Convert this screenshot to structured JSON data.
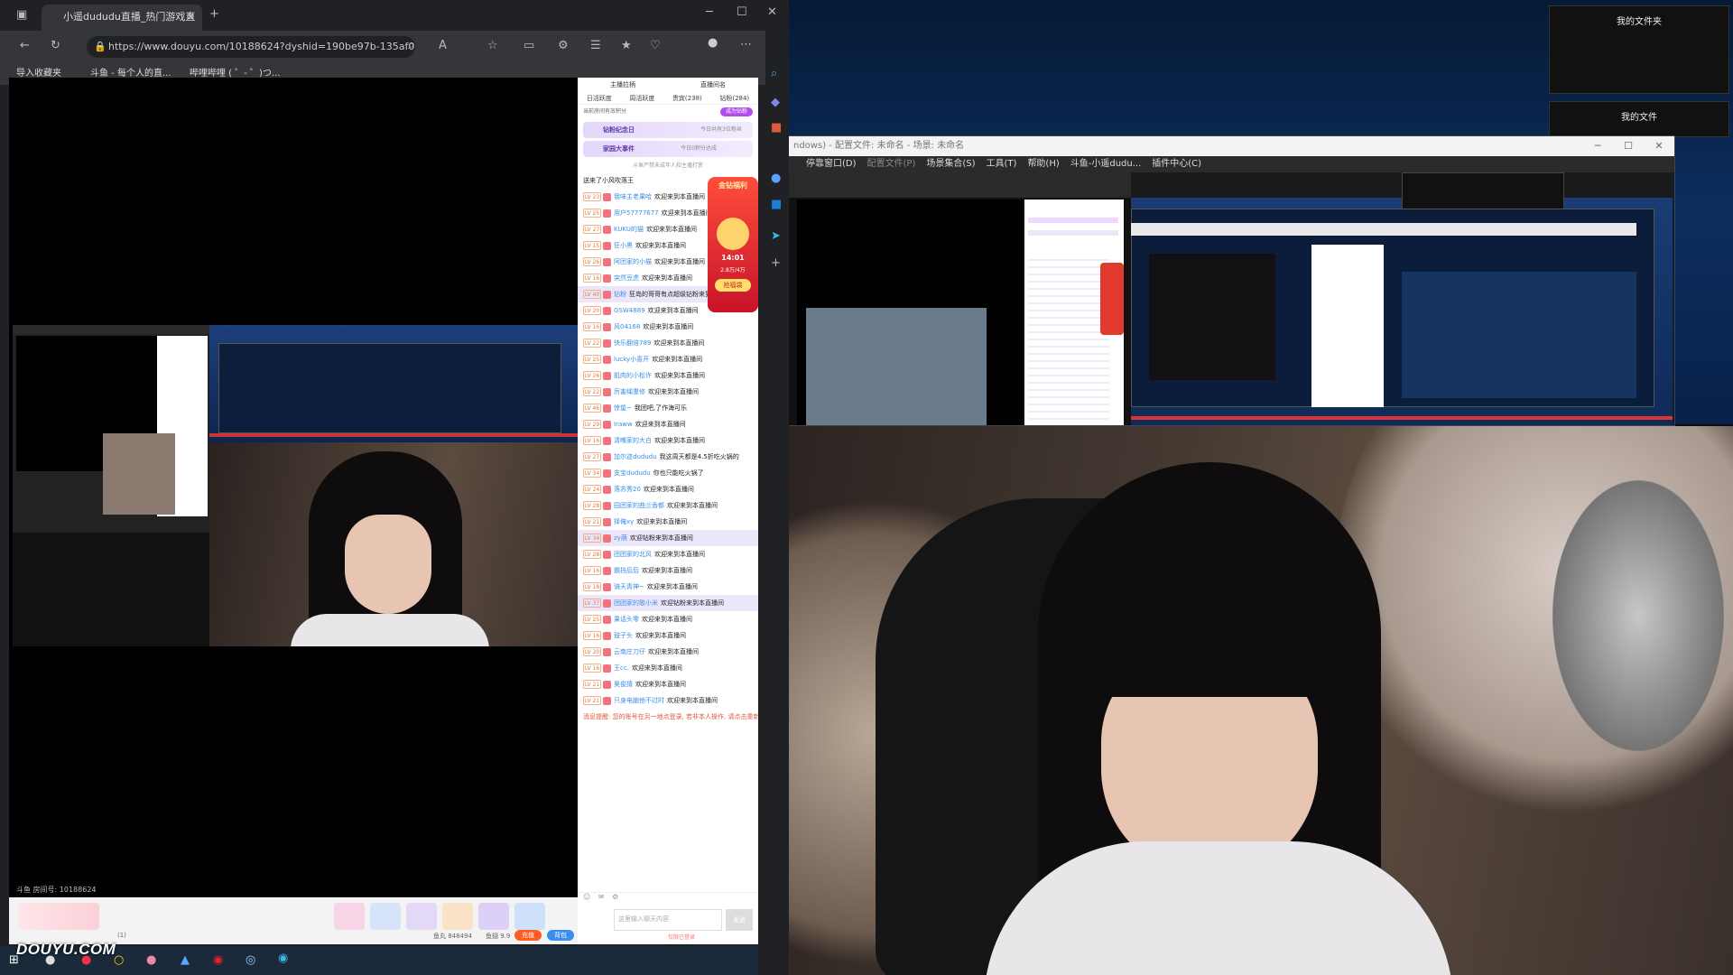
{
  "browser": {
    "tab_title": "小遥dududu直播_热门游戏直播",
    "url": "https://www.douyu.com/10188624?dyshid=190be97b-135af024881...",
    "bookmarks": [
      "导入收藏夹",
      "斗鱼 - 每个人的直...",
      "哔哩哔哩 ( ゜- ゜)つ..."
    ]
  },
  "chat": {
    "header_tabs": [
      "主播拉柄",
      "直播间名"
    ],
    "rank_tabs": [
      "日活跃度",
      "周活跃度",
      "贵宾(238)",
      "钻粉(284)"
    ],
    "notice": "当前房间有效积分",
    "activity_btn": "成为钻粉",
    "banner1": "钻粉纪念日",
    "banner1_sub": "今日共有3位粉丝",
    "banner2": "家园大事件",
    "banner2_sub": "今日0积分达成",
    "system_msg": "斗鱼严禁未成年人和主播打赏",
    "top_pin": "送来了小风吹落王",
    "lines": [
      {
        "lv": "LV 23",
        "user": "我味主老果哈",
        "text": "欢迎来到本直播间"
      },
      {
        "lv": "LV 25",
        "user": "用户57777677",
        "text": "欢迎来到本直播间"
      },
      {
        "lv": "LV 27",
        "user": "KUKU的猫",
        "text": "欢迎来到本直播间"
      },
      {
        "lv": "LV 15",
        "user": "狂小黑",
        "text": "欢迎来到本直播间"
      },
      {
        "lv": "LV 26",
        "user": "阿团家的小猫",
        "text": "欢迎来到本直播间"
      },
      {
        "lv": "LV 16",
        "user": "突然豆虎",
        "text": "欢迎来到本直播间"
      }
    ],
    "gift_line": {
      "lv": "LV 40",
      "user": "钻粉",
      "text": "狂岛的哥哥有点超级钻粉来到本直播间"
    },
    "lines2": [
      {
        "lv": "LV 20",
        "user": "GSW4889",
        "text": "欢迎来到本直播间"
      },
      {
        "lv": "LV 16",
        "user": "风04168",
        "text": "欢迎来到本直播间"
      },
      {
        "lv": "LV 22",
        "user": "快乐翻倍789",
        "text": "欢迎来到本直播间"
      },
      {
        "lv": "LV 25",
        "user": "lucky小喜开",
        "text": "欢迎来到本直播间"
      },
      {
        "lv": "LV 26",
        "user": "肌肉的小松许",
        "text": "欢迎来到本直播间"
      },
      {
        "lv": "LV 22",
        "user": "厉害绳重修",
        "text": "欢迎来到本直播间"
      }
    ],
    "fan_msgs": [
      {
        "lv": "LV 46",
        "user": "惊蛰~",
        "text": "我团吧,了作海可乐"
      },
      {
        "lv": "LV 29",
        "user": "Iraww",
        "text": "欢迎来到本直播间"
      },
      {
        "lv": "LV 16",
        "user": "清嘴家的大白",
        "text": "欢迎来到本直播间"
      },
      {
        "lv": "LV 27",
        "user": "加尔迩dududu",
        "text": "我这周天都是4.5折吃火锅的"
      },
      {
        "lv": "LV 34",
        "user": "支宝dududu",
        "text": "你也只能吃火锅了"
      }
    ],
    "lines3": [
      {
        "lv": "LV 24",
        "user": "落苏秀20",
        "text": "欢迎来到本直播间"
      },
      {
        "lv": "LV 28",
        "user": "园团家的曲兰香都",
        "text": "欢迎来到本直播间"
      },
      {
        "lv": "LV 21",
        "user": "择俺xy",
        "text": "欢迎来到本直播间"
      }
    ],
    "gift_line2": {
      "lv": "LV 34",
      "user": "zy荫",
      "text": "欢迎钻粉来到本直播间"
    },
    "lines4": [
      {
        "lv": "LV 28",
        "user": "团团家的北风",
        "text": "欢迎来到本直播间"
      },
      {
        "lv": "LV 16",
        "user": "霸挡后后",
        "text": "欢迎来到本直播间"
      },
      {
        "lv": "LV 18",
        "user": "骑天青神~",
        "text": "欢迎来到本直播间"
      }
    ],
    "gift_line3": {
      "lv": "LV 37",
      "user": "团团家的歌小米",
      "text": "欢迎钻粉来到本直播间"
    },
    "lines5": [
      {
        "lv": "LV 25",
        "user": "果话头零",
        "text": "欢迎来到本直播间"
      },
      {
        "lv": "LV 16",
        "user": "鼓子头",
        "text": "欢迎来到本直播间"
      },
      {
        "lv": "LV 20",
        "user": "云南庄刀仔",
        "text": "欢迎来到本直播间"
      },
      {
        "lv": "LV 16",
        "user": "王cc.",
        "text": "欢迎来到本直播间"
      },
      {
        "lv": "LV 21",
        "user": "奥俊猜",
        "text": "欢迎来到本直播间"
      },
      {
        "lv": "LV 21",
        "user": "只身电脑他不过时",
        "text": "欢迎来到本直播间"
      }
    ],
    "warn": "消息提醒: 您的账号在另一地点登录, 若非本人操作, 请点击重新登录",
    "input_placeholder": "这里输入聊天内容",
    "send_label": "发送",
    "bottom_tip": "仅限已登录"
  },
  "right_stage": {
    "file_panel_1": "我的文件夹",
    "file_panel_2": "我的文件",
    "obs_title": "ndows) - 配置文件: 未命名 - 场景: 未命名",
    "obs_menu": [
      "停靠窗口(D)",
      "配置文件(P)",
      "场景集合(S)",
      "工具(T)",
      "帮助(H)",
      "斗鱼-小遥dudu...",
      "插件中心(C)"
    ]
  },
  "player": {
    "room_id": "斗鱼 房间号: 10188624",
    "fans": "鱼丸 848494",
    "fish": "鱼翅 9.9",
    "recharge": "充值",
    "backpack": "背包",
    "count": "(1)"
  },
  "popup": {
    "title": "金钻福利",
    "countdown": "14:01",
    "amount": "2.8万/4万",
    "btn": "抢福袋"
  },
  "watermark": "DOUYU.COM"
}
